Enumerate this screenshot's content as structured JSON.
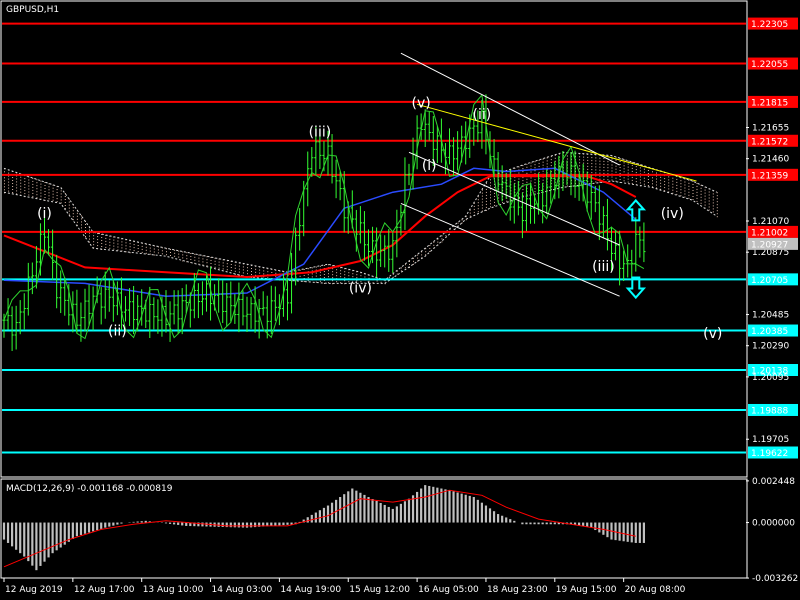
{
  "chart_data": {
    "type": "candlestick",
    "symbol_title": "GBPUSD,H1",
    "price_axis": {
      "ylim": [
        1.19475,
        1.2244
      ],
      "tick_labels": [
        "1.21655",
        "1.21460",
        "1.21070",
        "1.20875",
        "1.20485",
        "1.20290",
        "1.20095",
        "1.19705"
      ],
      "tick_values": [
        1.21655,
        1.2146,
        1.2107,
        1.20875,
        1.20485,
        1.2029,
        1.20095,
        1.19705
      ]
    },
    "time_axis": {
      "labels": [
        "12 Aug 2019",
        "12 Aug 17:00",
        "13 Aug 10:00",
        "14 Aug 03:00",
        "14 Aug 19:00",
        "15 Aug 12:00",
        "16 Aug 05:00",
        "18 Aug 23:00",
        "19 Aug 15:00",
        "20 Aug 08:00"
      ],
      "label_bars": [
        0,
        17,
        34,
        51,
        68,
        85,
        102,
        119,
        136,
        153
      ]
    },
    "current_price": {
      "value": 1.20927,
      "label": "1.20927"
    },
    "resistance_levels": [
      {
        "value": 1.22305,
        "label": "1.22305",
        "color": "#ff0000"
      },
      {
        "value": 1.22055,
        "label": "1.22055",
        "color": "#ff0000"
      },
      {
        "value": 1.21815,
        "label": "1.21815",
        "color": "#ff0000"
      },
      {
        "value": 1.21572,
        "label": "1.21572",
        "color": "#ff0000"
      },
      {
        "value": 1.21359,
        "label": "1.21359",
        "color": "#ff0000"
      },
      {
        "value": 1.21002,
        "label": "1.21002",
        "color": "#ff0000"
      }
    ],
    "support_levels": [
      {
        "value": 1.20705,
        "label": "1.20705",
        "color": "#00ffff"
      },
      {
        "value": 1.20385,
        "label": "1.20385",
        "color": "#00ffff"
      },
      {
        "value": 1.20138,
        "label": "1.20138",
        "color": "#00ffff"
      },
      {
        "value": 1.19888,
        "label": "1.19888",
        "color": "#00ffff"
      },
      {
        "value": 1.19622,
        "label": "1.19622",
        "color": "#00ffff"
      }
    ],
    "price_path": [
      [
        0,
        1.2045
      ],
      [
        3,
        1.204
      ],
      [
        7,
        1.2075
      ],
      [
        10,
        1.2102
      ],
      [
        13,
        1.2065
      ],
      [
        18,
        1.2045
      ],
      [
        22,
        1.2058
      ],
      [
        26,
        1.206
      ],
      [
        30,
        1.2052
      ],
      [
        35,
        1.205
      ],
      [
        40,
        1.2047
      ],
      [
        45,
        1.2055
      ],
      [
        50,
        1.2062
      ],
      [
        55,
        1.2055
      ],
      [
        60,
        1.205
      ],
      [
        65,
        1.205
      ],
      [
        70,
        1.206
      ],
      [
        73,
        1.211
      ],
      [
        76,
        1.2152
      ],
      [
        80,
        1.2148
      ],
      [
        84,
        1.2115
      ],
      [
        88,
        1.21
      ],
      [
        90,
        1.209
      ],
      [
        93,
        1.2087
      ],
      [
        96,
        1.209
      ],
      [
        99,
        1.213
      ],
      [
        103,
        1.217
      ],
      [
        105,
        1.216
      ],
      [
        107,
        1.2155
      ],
      [
        110,
        1.2148
      ],
      [
        113,
        1.2155
      ],
      [
        116,
        1.2165
      ],
      [
        118,
        1.217
      ],
      [
        121,
        1.214
      ],
      [
        124,
        1.2125
      ],
      [
        128,
        1.2112
      ],
      [
        130,
        1.2118
      ],
      [
        133,
        1.2122
      ],
      [
        136,
        1.2135
      ],
      [
        139,
        1.2138
      ],
      [
        142,
        1.213
      ],
      [
        145,
        1.2122
      ],
      [
        148,
        1.2105
      ],
      [
        150,
        1.209
      ],
      [
        152,
        1.2082
      ],
      [
        154,
        1.2078
      ],
      [
        156,
        1.2095
      ],
      [
        158,
        1.2093
      ]
    ],
    "moving_averages": [
      {
        "color": "#ff0000",
        "points": [
          [
            0,
            1.2098
          ],
          [
            8,
            1.209
          ],
          [
            20,
            1.2078
          ],
          [
            40,
            1.2075
          ],
          [
            60,
            1.2072
          ],
          [
            76,
            1.2075
          ],
          [
            88,
            1.2082
          ],
          [
            96,
            1.2092
          ],
          [
            104,
            1.211
          ],
          [
            112,
            1.2125
          ],
          [
            120,
            1.2135
          ],
          [
            132,
            1.2135
          ],
          [
            144,
            1.2135
          ],
          [
            150,
            1.213
          ],
          [
            156,
            1.2122
          ]
        ]
      },
      {
        "color": "#2a4bff",
        "points": [
          [
            0,
            1.207
          ],
          [
            20,
            1.2068
          ],
          [
            40,
            1.206
          ],
          [
            60,
            1.2062
          ],
          [
            74,
            1.208
          ],
          [
            84,
            1.2115
          ],
          [
            96,
            1.2125
          ],
          [
            108,
            1.213
          ],
          [
            116,
            1.214
          ],
          [
            124,
            1.2138
          ],
          [
            136,
            1.214
          ],
          [
            148,
            1.2125
          ],
          [
            156,
            1.2108
          ]
        ]
      }
    ],
    "cloud": {
      "upper": [
        [
          0,
          1.214
        ],
        [
          14,
          1.2128
        ],
        [
          22,
          1.21
        ],
        [
          40,
          1.209
        ],
        [
          60,
          1.208
        ],
        [
          70,
          1.2075
        ],
        [
          80,
          1.208
        ],
        [
          88,
          1.2075
        ],
        [
          94,
          1.207
        ],
        [
          104,
          1.209
        ],
        [
          114,
          1.211
        ],
        [
          120,
          1.2135
        ],
        [
          128,
          1.2142
        ],
        [
          138,
          1.215
        ],
        [
          150,
          1.2148
        ],
        [
          160,
          1.214
        ],
        [
          170,
          1.2132
        ],
        [
          176,
          1.2125
        ]
      ],
      "lower": [
        [
          0,
          1.2125
        ],
        [
          14,
          1.2118
        ],
        [
          22,
          1.209
        ],
        [
          40,
          1.2085
        ],
        [
          60,
          1.2072
        ],
        [
          70,
          1.207
        ],
        [
          80,
          1.2068
        ],
        [
          88,
          1.2068
        ],
        [
          94,
          1.2068
        ],
        [
          104,
          1.2085
        ],
        [
          114,
          1.2108
        ],
        [
          120,
          1.2115
        ],
        [
          128,
          1.2122
        ],
        [
          138,
          1.2128
        ],
        [
          150,
          1.2132
        ],
        [
          160,
          1.2128
        ],
        [
          170,
          1.212
        ],
        [
          176,
          1.211
        ]
      ]
    },
    "trend_lines": [
      {
        "color": "#ffffff",
        "from": [
          98,
          1.2212
        ],
        "to": [
          152,
          1.2142
        ]
      },
      {
        "color": "#ffffff",
        "from": [
          100,
          1.215
        ],
        "to": [
          152,
          1.2092
        ]
      },
      {
        "color": "#ffffff",
        "from": [
          98,
          1.2118
        ],
        "to": [
          152,
          1.206
        ]
      },
      {
        "color": "#ffff00",
        "from": [
          102,
          1.218
        ],
        "to": [
          171,
          1.2132
        ]
      }
    ],
    "wave_labels": [
      {
        "text": "(i)",
        "bar": 10,
        "price": 1.2112
      },
      {
        "text": "(ii)",
        "bar": 28,
        "price": 1.20385
      },
      {
        "text": "(iii)",
        "bar": 78,
        "price": 1.2163
      },
      {
        "text": "(iv)",
        "bar": 88,
        "price": 1.20655
      },
      {
        "text": "(v)",
        "bar": 103,
        "price": 1.2181
      },
      {
        "text": "(i)",
        "bar": 105,
        "price": 1.2142
      },
      {
        "text": "(ii)",
        "bar": 118,
        "price": 1.2174
      },
      {
        "text": "(iii)",
        "bar": 148,
        "price": 1.2079
      },
      {
        "text": "(iv)",
        "bar": 165,
        "price": 1.2112
      },
      {
        "text": "(v)",
        "bar": 175,
        "price": 1.2037
      }
    ],
    "arrows": [
      {
        "direction": "up",
        "color": "#00ffff",
        "bar": 156,
        "price": 1.2113
      },
      {
        "direction": "down",
        "color": "#00ffff",
        "bar": 156,
        "price": 1.2066
      }
    ],
    "macd": {
      "title": "MACD(12,26,9) -0.001168 -0.000819",
      "params": [
        12,
        26,
        9
      ],
      "macd_value": -0.001168,
      "signal_value": -0.000819,
      "ylim": [
        -0.0032,
        0.0025
      ],
      "tick_labels": [
        "0.002448",
        "0.000000",
        "-0.003262"
      ],
      "tick_values": [
        0.002448,
        0.0,
        -0.003262
      ],
      "histogram_keypoints": [
        [
          0,
          -0.001
        ],
        [
          5,
          -0.002
        ],
        [
          8,
          -0.0028
        ],
        [
          12,
          -0.0018
        ],
        [
          18,
          -0.0008
        ],
        [
          25,
          -0.0003
        ],
        [
          30,
          0.0
        ],
        [
          35,
          0.0001
        ],
        [
          45,
          -0.0002
        ],
        [
          60,
          -0.0003
        ],
        [
          72,
          -0.0001
        ],
        [
          80,
          0.001
        ],
        [
          86,
          0.002
        ],
        [
          90,
          0.0015
        ],
        [
          96,
          0.0008
        ],
        [
          100,
          0.0014
        ],
        [
          104,
          0.0022
        ],
        [
          110,
          0.0019
        ],
        [
          116,
          0.0015
        ],
        [
          122,
          0.0005
        ],
        [
          128,
          -0.0001
        ],
        [
          140,
          -0.0001
        ],
        [
          145,
          -0.0003
        ],
        [
          150,
          -0.001
        ],
        [
          156,
          -0.0012
        ]
      ],
      "signal_keypoints": [
        [
          0,
          -0.0026
        ],
        [
          8,
          -0.0018
        ],
        [
          16,
          -0.001
        ],
        [
          24,
          -0.0004
        ],
        [
          32,
          -0.0001
        ],
        [
          40,
          0.0001
        ],
        [
          55,
          -0.0002
        ],
        [
          70,
          -0.0002
        ],
        [
          80,
          0.0004
        ],
        [
          88,
          0.0014
        ],
        [
          96,
          0.0012
        ],
        [
          104,
          0.0015
        ],
        [
          110,
          0.0019
        ],
        [
          118,
          0.0016
        ],
        [
          124,
          0.0009
        ],
        [
          132,
          0.0002
        ],
        [
          140,
          -0.0001
        ],
        [
          148,
          -0.0004
        ],
        [
          156,
          -0.0008
        ]
      ]
    }
  }
}
